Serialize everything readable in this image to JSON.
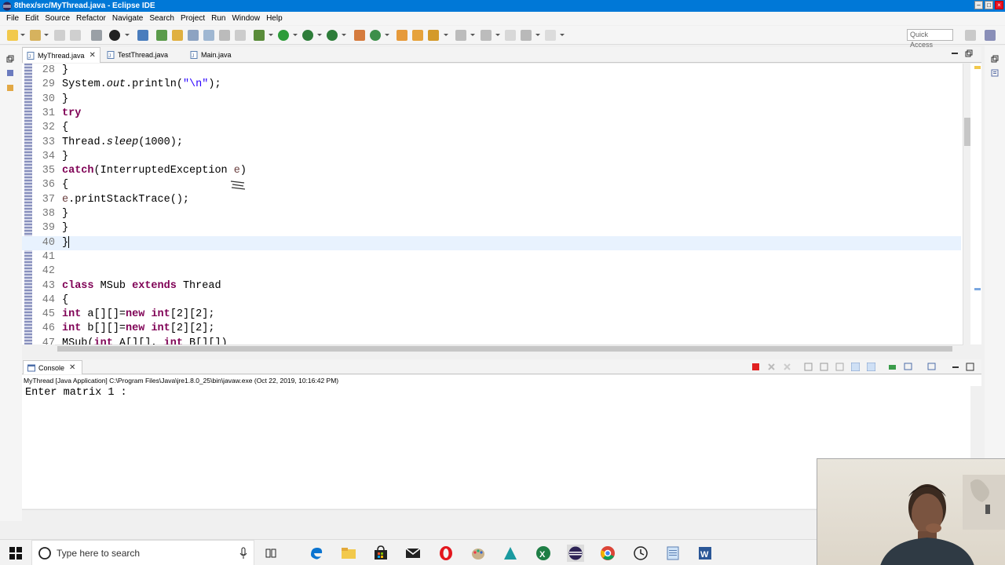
{
  "window": {
    "title": "8thex/src/MyThread.java - Eclipse IDE"
  },
  "menu": [
    "File",
    "Edit",
    "Source",
    "Refactor",
    "Navigate",
    "Search",
    "Project",
    "Run",
    "Window",
    "Help"
  ],
  "quick_access_placeholder": "Quick Access",
  "editor_tabs": [
    {
      "label": "MyThread.java",
      "active": true
    },
    {
      "label": "TestThread.java",
      "active": false
    },
    {
      "label": "Main.java",
      "active": false
    }
  ],
  "code_lines": [
    {
      "n": "28",
      "t": "}"
    },
    {
      "n": "29",
      "t": "System.out.println(\"\\n\");"
    },
    {
      "n": "30",
      "t": "}"
    },
    {
      "n": "31",
      "t": "try"
    },
    {
      "n": "32",
      "t": "{"
    },
    {
      "n": "33",
      "t": "Thread.sleep(1000);"
    },
    {
      "n": "34",
      "t": "}"
    },
    {
      "n": "35",
      "t": "catch(InterruptedException e)"
    },
    {
      "n": "36",
      "t": "{"
    },
    {
      "n": "37",
      "t": "e.printStackTrace();"
    },
    {
      "n": "38",
      "t": "}"
    },
    {
      "n": "39",
      "t": "}"
    },
    {
      "n": "40",
      "t": "}"
    },
    {
      "n": "41",
      "t": ""
    },
    {
      "n": "42",
      "t": ""
    },
    {
      "n": "43",
      "t": "class MSub extends Thread"
    },
    {
      "n": "44",
      "t": "{"
    },
    {
      "n": "45",
      "t": "int a[][]=new int[2][2];"
    },
    {
      "n": "46",
      "t": "int b[][]=new int[2][2];"
    },
    {
      "n": "47",
      "t": "MSub(int A[][], int B[][])"
    }
  ],
  "current_line": "40",
  "console": {
    "tab_label": "Console",
    "description": "MyThread [Java Application] C:\\Program Files\\Java\\jre1.8.0_25\\bin\\javaw.exe (Oct 22, 2019, 10:16:42 PM)",
    "output": "Enter matrix 1 :"
  },
  "taskbar": {
    "search_placeholder": "Type here to search",
    "apps": [
      "task-view-icon",
      "edge-icon",
      "file-explorer-icon",
      "store-icon",
      "mail-icon",
      "opera-icon",
      "paint-icon",
      "arduino-icon",
      "excel-icon",
      "eclipse-icon",
      "chrome-icon",
      "clock-app-icon",
      "notepad-icon",
      "word-icon"
    ]
  },
  "colors": {
    "keyword": "#7f0055",
    "string": "#2a00ff",
    "line_number": "#787878",
    "current_line": "#e8f2fe",
    "titlebar": "#0078d7",
    "terminate": "#e02020"
  }
}
